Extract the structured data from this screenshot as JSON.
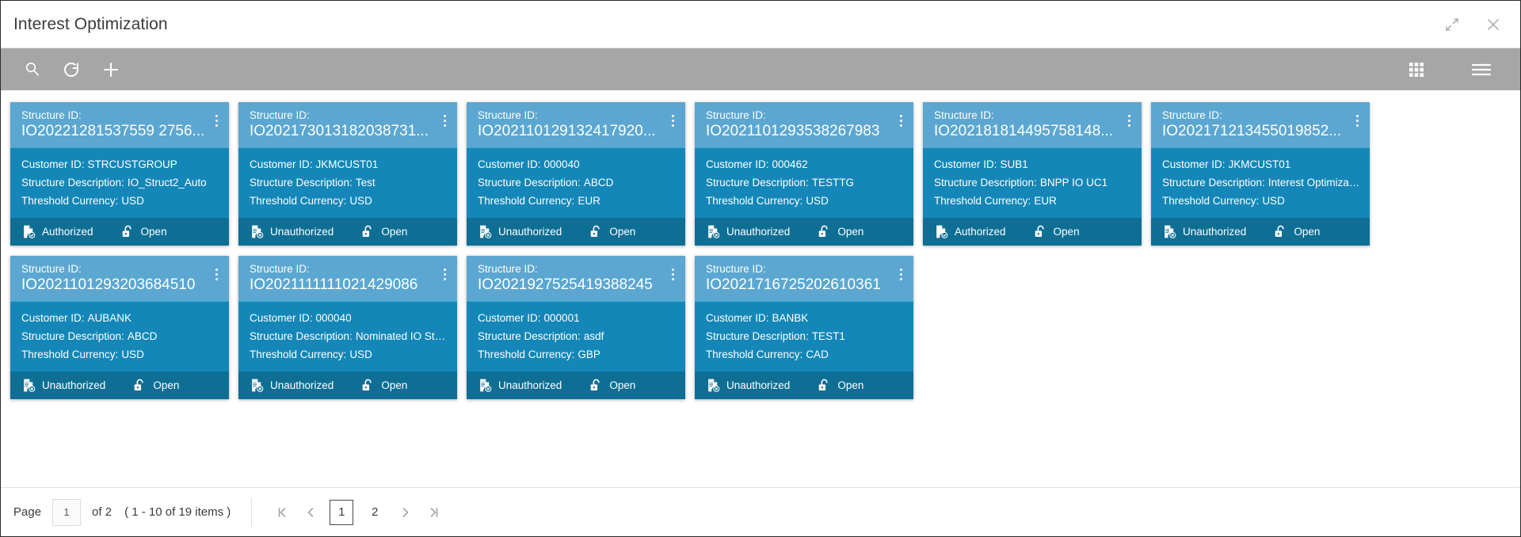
{
  "window": {
    "title": "Interest Optimization",
    "collapse_icon": "collapse-arrows-icon",
    "close_icon": "close-icon"
  },
  "toolbar": {
    "search_icon": "search-icon",
    "refresh_icon": "refresh-icon",
    "add_icon": "plus-icon",
    "grid_view_icon": "grid-view-icon",
    "menu_icon": "hamburger-menu-icon"
  },
  "labels": {
    "structure_id": "Structure ID:",
    "customer_id": "Customer ID:",
    "structure_description": "Structure Description:",
    "threshold_currency": "Threshold Currency:"
  },
  "cards": [
    {
      "structure_id": "IO20221281537559 2756...",
      "customer_id": "STRCUSTGROUP",
      "structure_description": "IO_Struct2_Auto",
      "threshold_currency": "USD",
      "auth_status": "Authorized",
      "auth_icon": "document-check-icon",
      "record_status": "Open",
      "record_icon": "open-padlock-icon"
    },
    {
      "structure_id": "IO202173013182038731...",
      "customer_id": "JKMCUST01",
      "structure_description": "Test",
      "threshold_currency": "USD",
      "auth_status": "Unauthorized",
      "auth_icon": "document-cross-icon",
      "record_status": "Open",
      "record_icon": "open-padlock-icon"
    },
    {
      "structure_id": "IO202110129132417920...",
      "customer_id": "000040",
      "structure_description": "ABCD",
      "threshold_currency": "EUR",
      "auth_status": "Unauthorized",
      "auth_icon": "document-cross-icon",
      "record_status": "Open",
      "record_icon": "open-padlock-icon"
    },
    {
      "structure_id": "IO2021101293538267983",
      "customer_id": "000462",
      "structure_description": "TESTTG",
      "threshold_currency": "USD",
      "auth_status": "Unauthorized",
      "auth_icon": "document-cross-icon",
      "record_status": "Open",
      "record_icon": "open-padlock-icon"
    },
    {
      "structure_id": "IO202181814495758148...",
      "customer_id": "SUB1",
      "structure_description": "BNPP IO UC1",
      "threshold_currency": "EUR",
      "auth_status": "Authorized",
      "auth_icon": "document-check-icon",
      "record_status": "Open",
      "record_icon": "open-padlock-icon"
    },
    {
      "structure_id": "IO202171213455019852...",
      "customer_id": "JKMCUST01",
      "structure_description": "Interest Optimizati...",
      "threshold_currency": "USD",
      "auth_status": "Unauthorized",
      "auth_icon": "document-cross-icon",
      "record_status": "Open",
      "record_icon": "open-padlock-icon"
    },
    {
      "structure_id": "IO2021101293203684510",
      "customer_id": "AUBANK",
      "structure_description": "ABCD",
      "threshold_currency": "USD",
      "auth_status": "Unauthorized",
      "auth_icon": "document-cross-icon",
      "record_status": "Open",
      "record_icon": "open-padlock-icon"
    },
    {
      "structure_id": "IO2021111111021429086",
      "customer_id": "000040",
      "structure_description": "Nominated IO Stru...",
      "threshold_currency": "USD",
      "auth_status": "Unauthorized",
      "auth_icon": "document-cross-icon",
      "record_status": "Open",
      "record_icon": "open-padlock-icon"
    },
    {
      "structure_id": "IO2021927525419388245",
      "customer_id": "000001",
      "structure_description": "asdf",
      "threshold_currency": "GBP",
      "auth_status": "Unauthorized",
      "auth_icon": "document-cross-icon",
      "record_status": "Open",
      "record_icon": "open-padlock-icon"
    },
    {
      "structure_id": "IO2021716725202610361",
      "customer_id": "BANBK",
      "structure_description": "TEST1",
      "threshold_currency": "CAD",
      "auth_status": "Unauthorized",
      "auth_icon": "document-cross-icon",
      "record_status": "Open",
      "record_icon": "open-padlock-icon"
    }
  ],
  "pagination": {
    "page_label": "Page",
    "page_value": "1",
    "of_text": "of 2",
    "items_text": "( 1 - 10 of 19 items )",
    "first_icon": "first-page-icon",
    "prev_icon": "previous-page-icon",
    "next_icon": "next-page-icon",
    "last_icon": "last-page-icon",
    "pages": [
      "1",
      "2"
    ],
    "active_page": "1"
  },
  "colors": {
    "card_header": "#5ba7d1",
    "card_body": "#1487b8",
    "card_footer": "#0f6e94",
    "toolbar": "#a6a6a6"
  }
}
